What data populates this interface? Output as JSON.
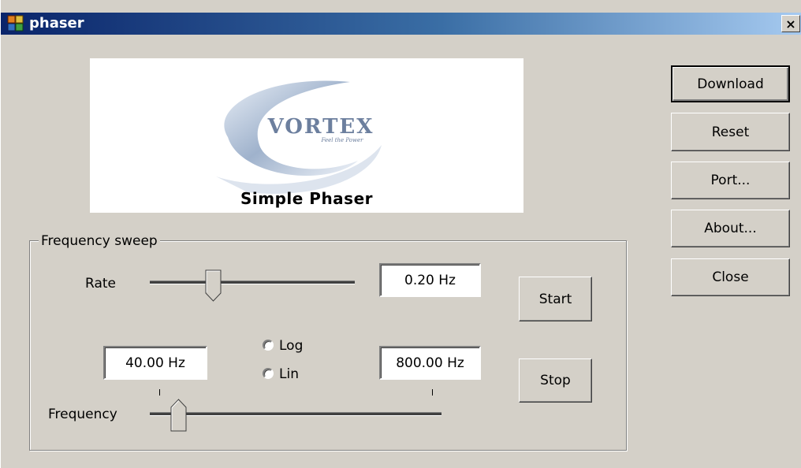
{
  "window": {
    "title": "phaser",
    "close_glyph": "×"
  },
  "logo": {
    "brand": "VORTEX",
    "tagline": "Feel the Power",
    "caption": "Simple Phaser"
  },
  "side_buttons": {
    "download": "Download",
    "reset": "Reset",
    "port": "Port...",
    "about": "About...",
    "close": "Close"
  },
  "sweep": {
    "group_label": "Frequency sweep",
    "rate_label": "Rate",
    "rate_value": "0.20 Hz",
    "rate_slider_level": 0.31,
    "start_label": "Start",
    "stop_label": "Stop",
    "freq_low": "40.00 Hz",
    "freq_high": "800.00 Hz",
    "log_label": "Log",
    "lin_label": "Lin",
    "frequency_label": "Frequency",
    "frequency_slider_level": 0.1
  },
  "icons": {
    "app": "app-icon",
    "close": "close-icon"
  }
}
